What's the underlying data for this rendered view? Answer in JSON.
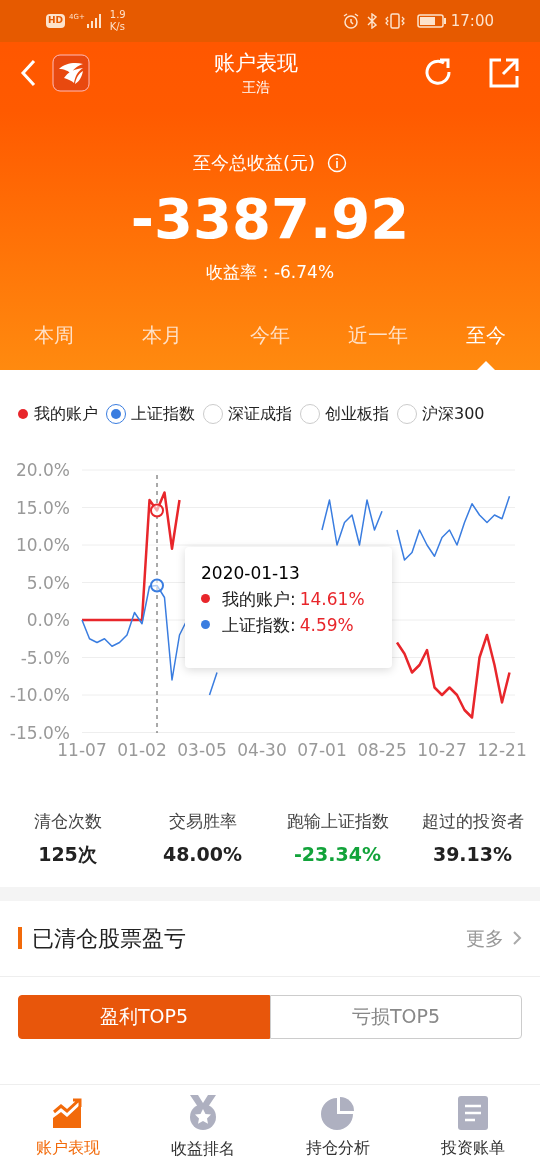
{
  "status_bar": {
    "hd": "HD",
    "network": "4G+",
    "speed_value": "1.9",
    "speed_unit": "K/s",
    "time": "17:00"
  },
  "header": {
    "title": "账户表现",
    "subtitle": "王浩"
  },
  "summary": {
    "label": "至今总收益(元)",
    "amount": "-3387.92",
    "rate": "收益率：-6.74%"
  },
  "period_tabs": [
    {
      "label": "本周",
      "selected": false
    },
    {
      "label": "本月",
      "selected": false
    },
    {
      "label": "今年",
      "selected": false
    },
    {
      "label": "近一年",
      "selected": false
    },
    {
      "label": "至今",
      "selected": true
    }
  ],
  "legend": [
    {
      "kind": "dot"
    },
    {
      "kind": "radio",
      "selected": true
    },
    {
      "kind": "radio",
      "label": "深证成指",
      "selected": false
    },
    {
      "kind": "radio",
      "label": "创业板指",
      "selected": false
    },
    {
      "kind": "radio",
      "label": "沪深300",
      "selected": false
    }
  ],
  "chart": {
    "chart_data": {
      "type": "line",
      "categories": [
        "11-07",
        null,
        null,
        null,
        null,
        null,
        null,
        null,
        "01-02",
        null,
        null,
        null,
        null,
        null,
        null,
        null,
        "03-05",
        null,
        null,
        null,
        null,
        null,
        null,
        null,
        "04-30",
        null,
        null,
        null,
        null,
        null,
        null,
        null,
        "07-01",
        null,
        null,
        null,
        null,
        null,
        null,
        null,
        "08-25",
        null,
        null,
        null,
        null,
        null,
        null,
        null,
        "10-27",
        null,
        null,
        null,
        null,
        null,
        null,
        null,
        "12-21",
        null
      ],
      "series": [
        {
          "name": "我的账户",
          "color": "#e8262b",
          "values": [
            0,
            0,
            0,
            0,
            0,
            0,
            0,
            0,
            0,
            16,
            14.6,
            17,
            9.5,
            16,
            null,
            null,
            null,
            null,
            null,
            null,
            null,
            null,
            null,
            null,
            null,
            null,
            null,
            null,
            null,
            null,
            null,
            null,
            null,
            null,
            null,
            null,
            null,
            null,
            null,
            null,
            null,
            null,
            -3,
            -4.5,
            -7,
            -6,
            -4,
            -9,
            -10,
            -9,
            -10,
            -12,
            -13,
            -5,
            -2,
            -6,
            -11,
            -7
          ]
        },
        {
          "name": "上证指数",
          "color": "#3a7de0",
          "values": [
            0,
            -2.5,
            -3,
            -2.5,
            -3.5,
            -3,
            -2,
            1,
            -0.5,
            4.5,
            4.6,
            3,
            -8,
            -2,
            0,
            null,
            null,
            -10,
            -7,
            null,
            null,
            null,
            null,
            null,
            null,
            null,
            null,
            null,
            null,
            null,
            null,
            null,
            12,
            16,
            10,
            13,
            14,
            10,
            16,
            12,
            14.5,
            null,
            12,
            8,
            9,
            12,
            10,
            8.5,
            11,
            12,
            10,
            13,
            15.5,
            14,
            13,
            14,
            13.5,
            16.5
          ]
        }
      ],
      "ylim": [
        -15,
        20
      ],
      "grid": true,
      "yticks": [
        {
          "value": 20,
          "label": "20.0%"
        },
        {
          "value": 15,
          "label": "15.0%"
        },
        {
          "value": 10,
          "label": "10.0%"
        },
        {
          "value": 5,
          "label": "5.0%"
        },
        {
          "value": 0,
          "label": "0.0%"
        },
        {
          "value": -5,
          "label": "-5.0%"
        },
        {
          "value": -10,
          "label": "-10.0%"
        },
        {
          "value": -15,
          "label": "-15.0%"
        }
      ]
    },
    "tooltip": {
      "date": "2020-01-13",
      "rows": [
        {
          "label": "我的账户:",
          "value": "14.61%",
          "color": "#e8262b"
        },
        {
          "label": "上证指数:",
          "value": "4.59%",
          "color": "#3a7de0"
        }
      ]
    }
  },
  "stats": [
    {
      "label": "清仓次数",
      "value": "125次",
      "kind": "plain"
    },
    {
      "label": "交易胜率",
      "value": "48.00%",
      "kind": "plain"
    },
    {
      "label": "跑输上证指数",
      "value": "-23.34%",
      "kind": "loss"
    },
    {
      "label": "超过的投资者",
      "value": "39.13%",
      "kind": "plain"
    }
  ],
  "section": {
    "title": "已清仓股票盈亏",
    "more": "更多"
  },
  "segments": [
    {
      "label": "盈利TOP5",
      "selected": true
    },
    {
      "label": "亏损TOP5",
      "selected": false
    }
  ],
  "bottom_nav": [
    {
      "label": "账户表现",
      "kind": "trend",
      "selected": true
    },
    {
      "label": "收益排名",
      "kind": "medal",
      "selected": false
    },
    {
      "label": "持仓分析",
      "kind": "pie",
      "selected": false
    },
    {
      "label": "投资账单",
      "kind": "doc",
      "selected": false
    }
  ]
}
